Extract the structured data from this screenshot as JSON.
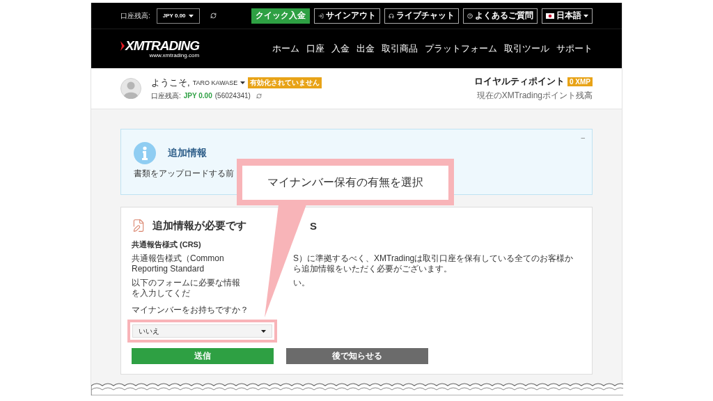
{
  "top_bar": {
    "balance_label": "口座残高:",
    "currency_select": "JPY 0.00",
    "buttons": [
      {
        "kind": "primary",
        "label": "クイック入金"
      },
      {
        "kind": "signout",
        "label": "サインアウト"
      },
      {
        "kind": "chat",
        "label": "ライブチャット"
      },
      {
        "kind": "faq",
        "label": "よくあるご質問"
      }
    ],
    "language": "日本語"
  },
  "logo": {
    "name": "XMTRADING",
    "url": "www.xmtrading.com"
  },
  "nav": [
    "ホーム",
    "口座",
    "入金",
    "出金",
    "取引商品",
    "プラットフォーム",
    "取引ツール",
    "サポート"
  ],
  "user": {
    "greeting": "ようこそ,",
    "name": "TARO KAWASE",
    "status_badge": "有効化されていません",
    "balance_label": "口座残高:",
    "balance": "JPY 0.00",
    "account": "(56024341)"
  },
  "loyalty": {
    "title": "ロイヤルティポイント",
    "points": "0 XMP",
    "caption": "現在のXMTradingポイント残高"
  },
  "info_panel": {
    "title": "追加情報",
    "text": "書類をアップロードする前",
    "collapse": "–"
  },
  "form": {
    "title": "追加情報が必要です",
    "title_tail": "S",
    "section": "共通報告様式 (CRS)",
    "lines": [
      [
        "共通報告様式（Common Reporting Standard",
        "S）に準拠するべく、XMTradingは取引口座を保有している全てのお客様から追加情報をいただく必要がございます。"
      ],
      [
        "以下のフォームに必要な情報を入力してくだ",
        "い。"
      ]
    ],
    "question": "マイナンバーをお持ちですか？",
    "answer": "いいえ",
    "buttons": [
      {
        "kind": "submit",
        "label": "送信"
      },
      {
        "kind": "later",
        "label": "後で知らせる"
      }
    ]
  },
  "callout": {
    "text": "マイナンバー保有の有無を選択"
  }
}
